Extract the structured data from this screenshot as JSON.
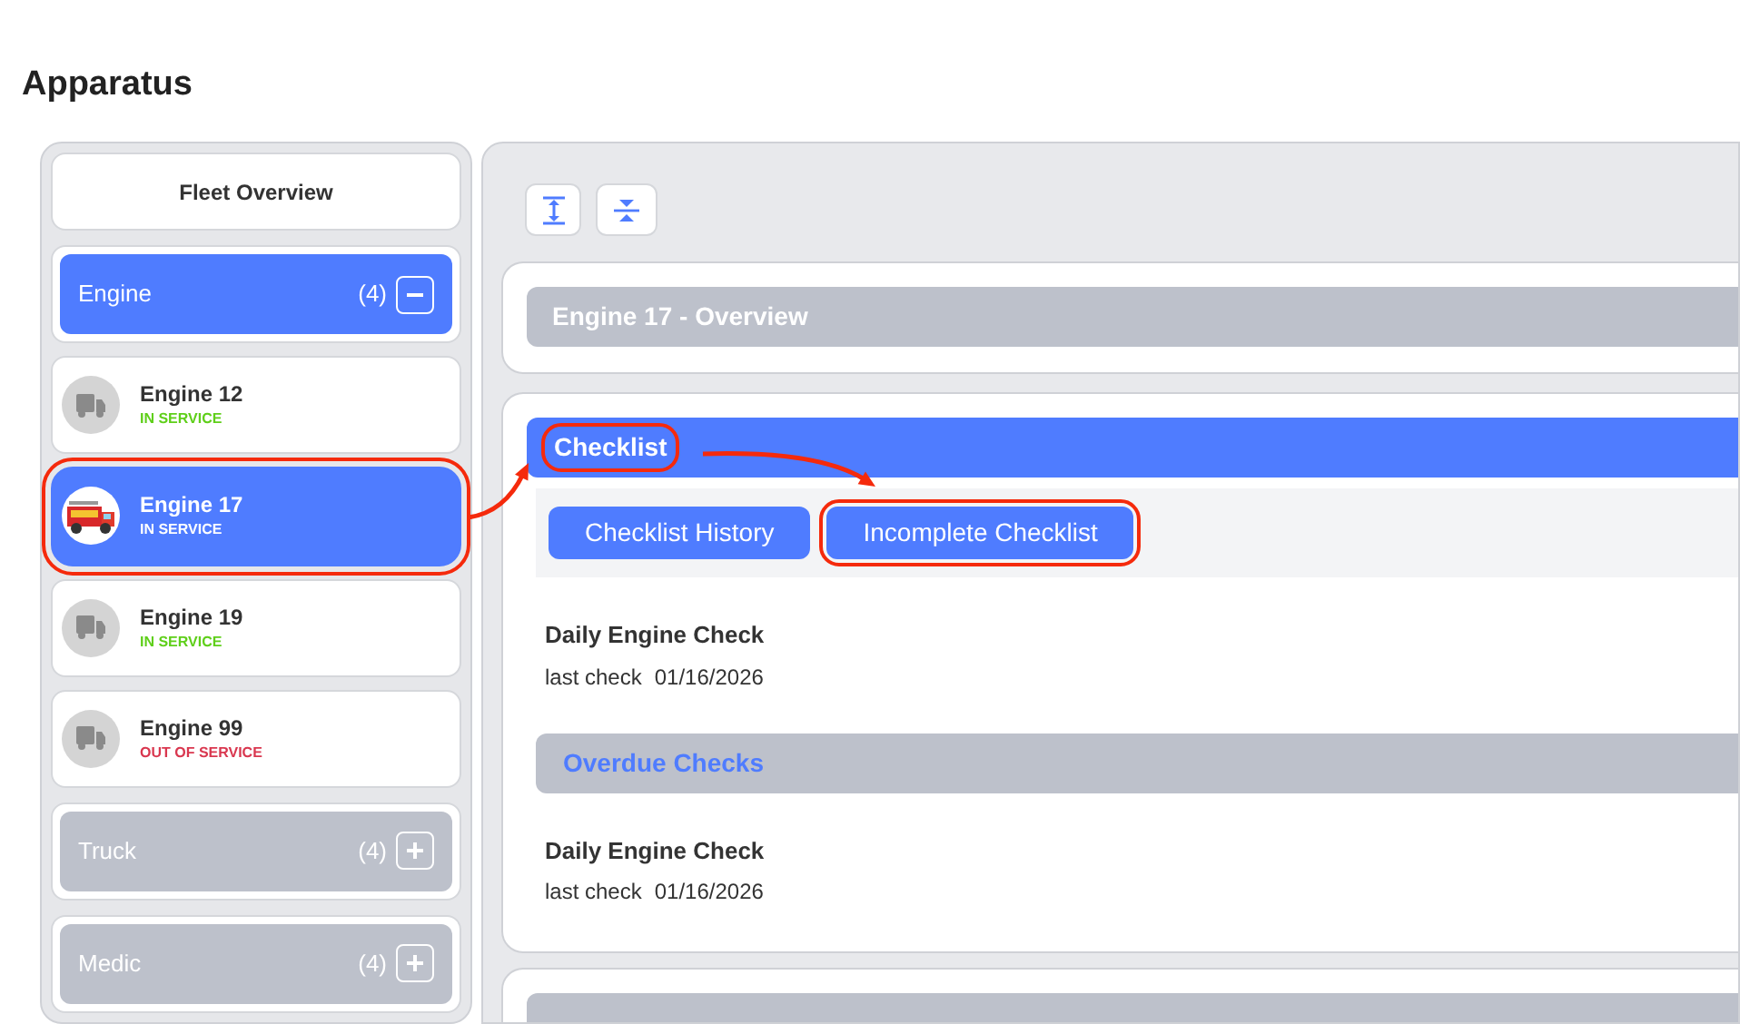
{
  "page": {
    "title": "Apparatus"
  },
  "sidebar": {
    "items": [
      {
        "kind": "overview",
        "label": "Fleet Overview"
      },
      {
        "kind": "group",
        "label": "Engine",
        "count": "(4)",
        "expanded": true,
        "children": [
          {
            "name": "Engine 12",
            "status": "IN SERVICE",
            "color": "#5fcf1a",
            "selected": false,
            "highlighted": false,
            "has_photo": false
          },
          {
            "name": "Engine 17",
            "status": "IN SERVICE",
            "color": "#ffffff",
            "selected": true,
            "highlighted": true,
            "has_photo": true
          },
          {
            "name": "Engine 19",
            "status": "IN SERVICE",
            "color": "#5fcf1a",
            "selected": false,
            "highlighted": false,
            "has_photo": false
          },
          {
            "name": "Engine 99",
            "status": "OUT OF SERVICE",
            "color": "#d9374f",
            "selected": false,
            "highlighted": false,
            "has_photo": false
          }
        ]
      },
      {
        "kind": "group",
        "label": "Truck",
        "count": "(4)",
        "expanded": false
      },
      {
        "kind": "group",
        "label": "Medic",
        "count": "(4)",
        "expanded": false
      }
    ]
  },
  "main": {
    "sections": [
      {
        "kind": "overview",
        "title": "Engine 17 - Overview"
      },
      {
        "kind": "checklist",
        "title": "Checklist",
        "highlighted": true,
        "tabs": [
          {
            "label": "Checklist History",
            "highlighted": false
          },
          {
            "label": "Incomplete Checklist",
            "highlighted": true
          }
        ],
        "items": [
          {
            "name": "Daily Engine Check",
            "label": "last check",
            "date": "01/16/2026"
          }
        ],
        "overdue": {
          "title": "Overdue Checks",
          "items": [
            {
              "name": "Daily Engine Check",
              "label": "last check",
              "date": "01/16/2026"
            }
          ]
        }
      },
      {
        "kind": "collapsed"
      }
    ]
  }
}
